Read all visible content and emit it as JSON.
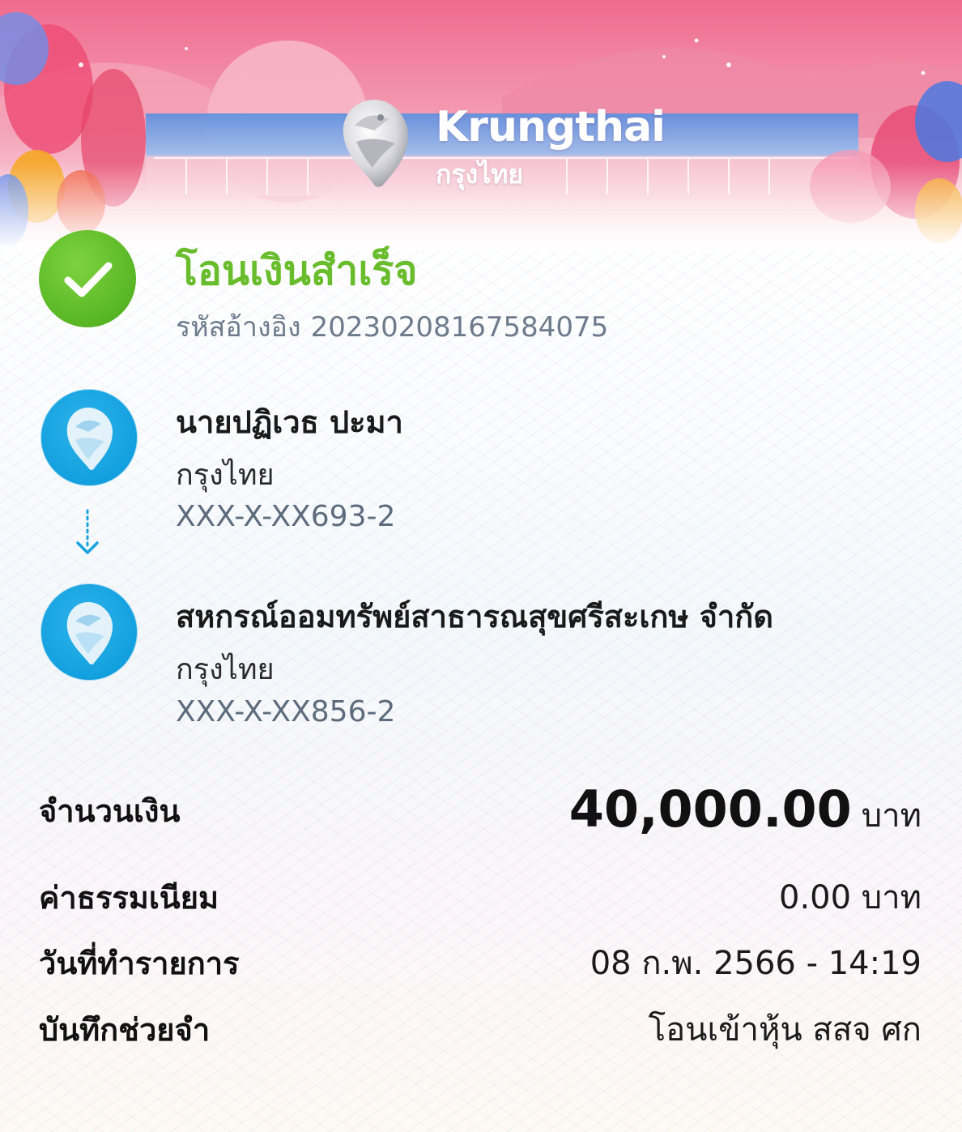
{
  "header": {
    "brand_en": "Krungthai",
    "brand_th": "กรุงไทย"
  },
  "status": {
    "title": "โอนเงินสำเร็จ",
    "ref_label": "รหัสอ้างอิง",
    "ref_number": "20230208167584075",
    "success_color": "#69bd2c"
  },
  "sender": {
    "name": "นายปฏิเวธ ปะมา",
    "bank": "กรุงไทย",
    "account": "XXX-X-XX693-2"
  },
  "receiver": {
    "name": "สหกรณ์ออมทรัพย์สาธารณสุขศรีสะเกษ จำกัด",
    "bank": "กรุงไทย",
    "account": "XXX-X-XX856-2"
  },
  "details": {
    "amount_label": "จำนวนเงิน",
    "amount_value": "40,000.00",
    "amount_unit": "บาท",
    "fee_label": "ค่าธรรมเนียม",
    "fee_value": "0.00 บาท",
    "date_label": "วันที่ทำรายการ",
    "date_value": "08 ก.พ. 2566 - 14:19",
    "memo_label": "บันทึกช่วยจำ",
    "memo_value": "โอนเข้าหุ้น สสจ ศก"
  },
  "icons": {
    "check": "check-icon",
    "bank_logo": "krungthai-bird-icon",
    "arrow": "arrow-down-icon"
  },
  "colors": {
    "brand_blue": "#13a0df",
    "banner_pink": "#ef8aa6"
  }
}
